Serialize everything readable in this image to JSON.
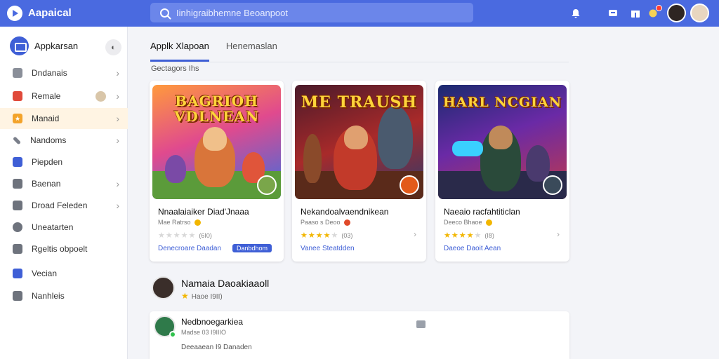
{
  "app": {
    "title": "Aapaical"
  },
  "search": {
    "text": "Iinhigraibhemne Beoanpoot"
  },
  "colors": {
    "accent": "#4a6ae0",
    "active_bg": "#fff4e3",
    "star": "#f2b600"
  },
  "topbar_icons": [
    "bell-icon",
    "chat-icon",
    "gift-icon",
    "notification-icon"
  ],
  "sidebar": {
    "header": "Appkarsan",
    "items": [
      {
        "label": "Dndanais",
        "icon": "grid-icon",
        "chevron": true
      },
      {
        "label": "Remale",
        "icon": "flag-icon",
        "chevron": true
      },
      {
        "label": "Manaid",
        "icon": "star-icon",
        "chevron": true,
        "active": true
      },
      {
        "label": "Nandoms",
        "icon": "pen-icon",
        "chevron": true
      },
      {
        "label": "Piepden",
        "icon": "box-icon",
        "chevron": false
      },
      {
        "label": "Baenan",
        "icon": "lock-icon",
        "chevron": true
      },
      {
        "label": "Droad Feleden",
        "icon": "users-icon",
        "chevron": true
      },
      {
        "label": "Uneatarten",
        "icon": "person-icon",
        "chevron": false
      },
      {
        "label": "Rgeltis obpoelt",
        "icon": "doc-icon",
        "chevron": false
      },
      {
        "label": "Vecian",
        "icon": "square-icon",
        "chevron": false
      },
      {
        "label": "Nanhleis",
        "icon": "note-icon",
        "chevron": false
      }
    ]
  },
  "tabs": [
    {
      "label": "Applk Xlapoan",
      "active": true
    },
    {
      "label": "Henemaslan",
      "active": false
    }
  ],
  "section_label": "Gectagors Ihs",
  "cards": [
    {
      "art_title": "BAGRIOH VDLNEAN",
      "name": "Nnaalaiaiker Diad'Jnaaa",
      "meta": "Mae Ratrso",
      "rating_stars": 0,
      "rating_count": "(6I0)",
      "link": "Denecroare Daadan",
      "pill": "Danbdhom"
    },
    {
      "art_title": "ME TRAUSH",
      "name": "Nekandoalvaendnikean",
      "meta": "Paaso s Deoo",
      "rating_stars": 4,
      "rating_count": "(03)",
      "link": "Vanee Steatdden",
      "pill": ""
    },
    {
      "art_title": "HARL NCGIAN",
      "name": "Naeaio racfahtiticlan",
      "meta": "Deeco Bhaoe",
      "rating_stars": 4,
      "rating_count": "(I8)",
      "link": "Daeoe Daoit Aean",
      "pill": ""
    }
  ],
  "developer": {
    "name": "Namaia Daoakiaaoll",
    "rating": "Haoe I9II)"
  },
  "list_item": {
    "title": "Nedbnoegarkiea",
    "sub": "Madse 03 I9IIIO",
    "foot": "Deeaaean I9 Danaden"
  }
}
